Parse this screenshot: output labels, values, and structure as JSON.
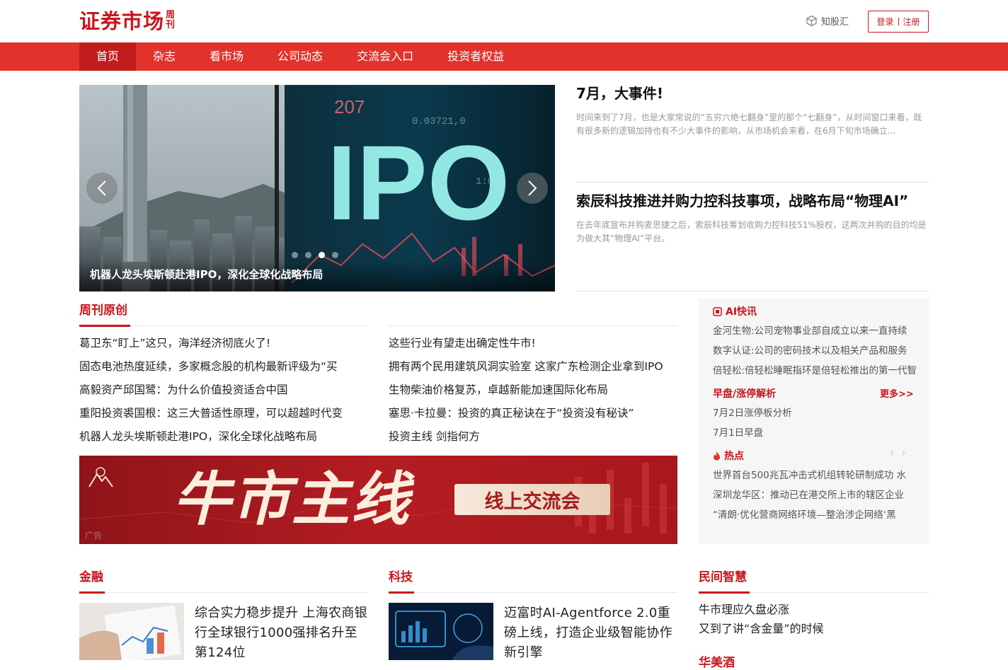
{
  "header": {
    "logo_main": "证券市场",
    "logo_sub": "周刊",
    "zhigu": "知股汇",
    "login": "登录",
    "register": "注册"
  },
  "nav": [
    "首页",
    "杂志",
    "看市场",
    "公司动态",
    "交流会入口",
    "投资者权益"
  ],
  "hero": {
    "caption": "机器人龙头埃斯顿赴港IPO，深化全球化战略布局",
    "image_text": "IPO",
    "slides": 4,
    "active_slide": 3
  },
  "headlines": [
    {
      "title": "7月，大事件!",
      "summary": "时间来到了7月，也是大家常说的“五穷六绝七翻身”里的那个“七翻身”，从时间窗口来看，既有很多新的逻辑加持也有不少大事件的影响，从市场机会来看，在6月下旬市场确立..."
    },
    {
      "title": "索辰科技推进并购力控科技事项，战略布局“物理AI”",
      "summary": "在去年底宣布并购麦思捷之后，索辰科技筹划收购力控科技51%股权，这两次并购的目的均是为做大其“物理AI”平台。"
    }
  ],
  "weekly": {
    "title": "周刊原创",
    "left": [
      "葛卫东“盯上”这只，海洋经济彻底火了!",
      "固态电池热度延续，多家概念股的机构最新评级为“买",
      "高毅资产邱国鹭：为什么价值投资适合中国",
      "重阳投资裘国根：这三大普适性原理，可以超越时代变",
      "机器人龙头埃斯顿赴港IPO，深化全球化战略布局"
    ],
    "right": [
      "这些行业有望走出确定性牛市!",
      "拥有两个民用建筑风洞实验室 这家广东检测企业拿到IPO",
      "生物柴油价格复苏，卓越新能加速国际化布局",
      "塞思·卡拉曼：投资的真正秘诀在于“投资没有秘诀”",
      "投资主线 剑指何方"
    ]
  },
  "banner": {
    "main": "牛市主线",
    "pill": "线上交流会",
    "ad": "广告"
  },
  "sidebar": {
    "ai_title": "AI快讯",
    "ai_items": [
      "金河生物:公司宠物事业部自成立以来一直持续",
      "数字认证:公司的密码技术以及相关产品和服务",
      "倍轻松:倍轻松睡眠指环是倍轻松推出的第一代智"
    ],
    "analysis_title": "早盘/涨停解析",
    "more": "更多>>",
    "analysis_items": [
      "7月2日涨停板分析",
      "7月1日早盘"
    ],
    "hot_title": "热点",
    "hot_items": [
      "世界首台500兆瓦冲击式机组转轮研制成功 水",
      "深圳龙华区：推动已在港交所上市的辖区企业",
      "“清朗·优化营商网络环境—整治涉企网络‘黑"
    ]
  },
  "sections": {
    "finance": {
      "title": "金融",
      "news": "综合实力稳步提升 上海农商银行全球银行1000强排名升至第124位"
    },
    "tech": {
      "title": "科技",
      "news": "迈富时AI-Agentforce 2.0重磅上线，打造企业级智能协作新引擎"
    },
    "wisdom": {
      "title": "民间智慧",
      "items": [
        "牛市理应久盘必涨",
        "又到了讲“含金量”的时候"
      ],
      "next_title": "华美酒"
    }
  },
  "colors": {
    "brand_red": "#c8161d",
    "nav_red": "#e1322c",
    "nav_active": "#c21d1d"
  }
}
